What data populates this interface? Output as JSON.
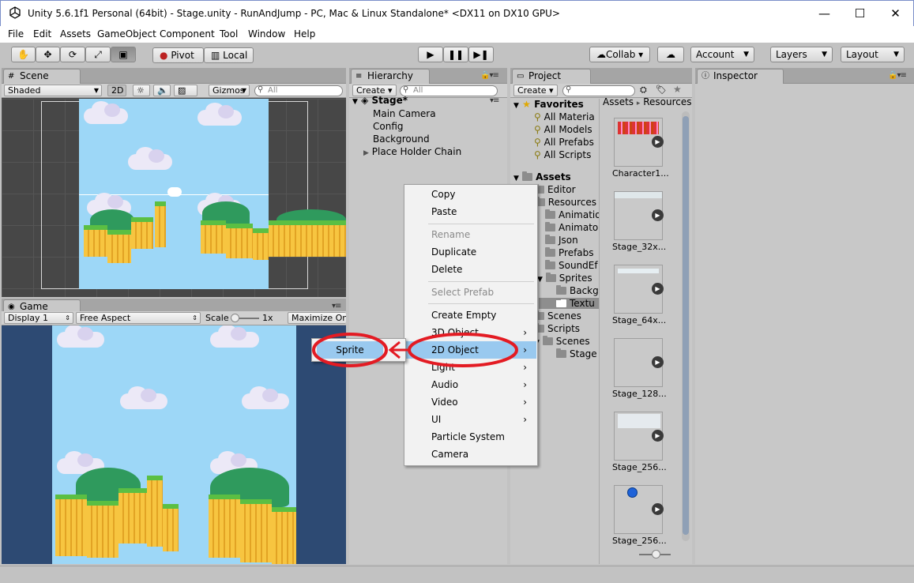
{
  "window": {
    "title": "Unity 5.6.1f1 Personal (64bit) - Stage.unity - RunAndJump - PC, Mac & Linux Standalone* <DX11 on DX10 GPU>",
    "minimize_glyph": "—",
    "maximize_glyph": "☐",
    "close_glyph": "✕"
  },
  "menu": [
    "File",
    "Edit",
    "Assets",
    "GameObject",
    "Component",
    "Tool",
    "Window",
    "Help"
  ],
  "toolbar": {
    "pivot": "Pivot",
    "local": "Local",
    "collab": "Collab ▾",
    "account": "Account",
    "layers": "Layers",
    "layout": "Layout"
  },
  "scene": {
    "tab": "Scene",
    "shading": "Shaded",
    "mode2d": "2D",
    "gizmos": "Gizmos",
    "search_placeholder": "All"
  },
  "game": {
    "tab": "Game",
    "display": "Display 1",
    "aspect": "Free Aspect",
    "scale_label": "Scale",
    "scale_value": "1x",
    "maximize": "Maximize On P"
  },
  "hierarchy": {
    "tab": "Hierarchy",
    "create": "Create ▾",
    "search_placeholder": "All",
    "scene_name": "Stage*",
    "items": [
      "Main Camera",
      "Config",
      "Background",
      "Place Holder Chain"
    ]
  },
  "project": {
    "tab": "Project",
    "create": "Create ▾",
    "favorites_label": "Favorites",
    "favorites": [
      "All Materia",
      "All Models",
      "All Prefabs",
      "All Scripts"
    ],
    "assets_label": "Assets",
    "assets_tree": [
      "Editor",
      "Resources",
      "Animatio",
      "Animato",
      "Json",
      "Prefabs",
      "SoundEf",
      "Sprites",
      "Backg",
      "Textu",
      "Scenes",
      "Scripts",
      "Scenes",
      "Stage"
    ],
    "breadcrumb_root": "Assets",
    "breadcrumb_sep": "▸",
    "breadcrumb_child": "Resources",
    "thumbnails": [
      "Character1...",
      "Stage_32x...",
      "Stage_64x...",
      "Stage_128...",
      "Stage_256...",
      "Stage_256..."
    ]
  },
  "inspector": {
    "tab": "Inspector"
  },
  "context_menu": {
    "items": [
      {
        "label": "Copy",
        "disabled": false,
        "submenu": false
      },
      {
        "label": "Paste",
        "disabled": false,
        "submenu": false
      },
      {
        "label": "Rename",
        "disabled": true,
        "submenu": false
      },
      {
        "label": "Duplicate",
        "disabled": false,
        "submenu": false
      },
      {
        "label": "Delete",
        "disabled": false,
        "submenu": false
      },
      {
        "label": "Select Prefab",
        "disabled": true,
        "submenu": false
      },
      {
        "label": "Create Empty",
        "disabled": false,
        "submenu": false
      },
      {
        "label": "3D Object",
        "disabled": false,
        "submenu": true
      },
      {
        "label": "2D Object",
        "disabled": false,
        "submenu": true
      },
      {
        "label": "Light",
        "disabled": false,
        "submenu": true
      },
      {
        "label": "Audio",
        "disabled": false,
        "submenu": true
      },
      {
        "label": "Video",
        "disabled": false,
        "submenu": true
      },
      {
        "label": "UI",
        "disabled": false,
        "submenu": true
      },
      {
        "label": "Particle System",
        "disabled": false,
        "submenu": false
      },
      {
        "label": "Camera",
        "disabled": false,
        "submenu": false
      }
    ],
    "highlighted": "2D Object",
    "submenu_arrow": "›",
    "submenu_item": "Sprite"
  },
  "colors": {
    "highlight": "#99c9ef",
    "annotation_red": "#e31b23",
    "sky": "#9dd7f7",
    "game_border": "#2d4a73"
  }
}
